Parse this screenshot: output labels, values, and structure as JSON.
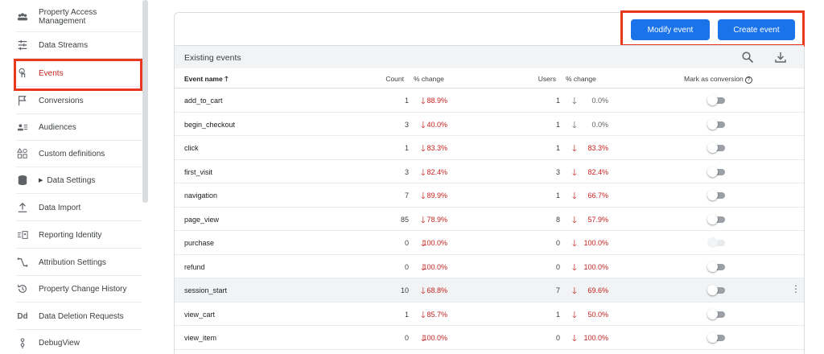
{
  "sidebar": {
    "items": [
      {
        "label": "Property Access Management",
        "icon": "people-icon"
      },
      {
        "label": "Data Streams",
        "icon": "streams-icon"
      },
      {
        "label": "Events",
        "icon": "touch-icon"
      },
      {
        "label": "Conversions",
        "icon": "flag-icon"
      },
      {
        "label": "Audiences",
        "icon": "audience-icon"
      },
      {
        "label": "Custom definitions",
        "icon": "shapes-icon"
      },
      {
        "label": "Data Settings",
        "icon": "database-icon"
      },
      {
        "label": "Data Import",
        "icon": "upload-icon"
      },
      {
        "label": "Reporting Identity",
        "icon": "identity-icon"
      },
      {
        "label": "Attribution Settings",
        "icon": "attribution-icon"
      },
      {
        "label": "Property Change History",
        "icon": "history-icon"
      },
      {
        "label": "Data Deletion Requests",
        "icon": "dd-icon"
      },
      {
        "label": "DebugView",
        "icon": "debug-icon"
      }
    ]
  },
  "actions": {
    "modify": "Modify event",
    "create": "Create event"
  },
  "table": {
    "title": "Existing events",
    "headers": {
      "name": "Event name",
      "count": "Count",
      "count_change": "% change",
      "users": "Users",
      "users_change": "% change",
      "conversion": "Mark as conversion"
    },
    "rows": [
      {
        "name": "add_to_cart",
        "count": "1",
        "count_change": "88.9%",
        "count_dir": "down-red",
        "users": "1",
        "users_change": "0.0%",
        "users_dir": "down-gray",
        "conversion": false,
        "enabled": true
      },
      {
        "name": "begin_checkout",
        "count": "3",
        "count_change": "40.0%",
        "count_dir": "down-red",
        "users": "1",
        "users_change": "0.0%",
        "users_dir": "down-gray",
        "conversion": false,
        "enabled": true
      },
      {
        "name": "click",
        "count": "1",
        "count_change": "83.3%",
        "count_dir": "down-red",
        "users": "1",
        "users_change": "83.3%",
        "users_dir": "down-red",
        "conversion": false,
        "enabled": true
      },
      {
        "name": "first_visit",
        "count": "3",
        "count_change": "82.4%",
        "count_dir": "down-red",
        "users": "3",
        "users_change": "82.4%",
        "users_dir": "down-red",
        "conversion": false,
        "enabled": true
      },
      {
        "name": "navigation",
        "count": "7",
        "count_change": "89.9%",
        "count_dir": "down-red",
        "users": "1",
        "users_change": "66.7%",
        "users_dir": "down-red",
        "conversion": false,
        "enabled": true
      },
      {
        "name": "page_view",
        "count": "85",
        "count_change": "78.9%",
        "count_dir": "down-red",
        "users": "8",
        "users_change": "57.9%",
        "users_dir": "down-red",
        "conversion": false,
        "enabled": true
      },
      {
        "name": "purchase",
        "count": "0",
        "count_change": "100.0%",
        "count_dir": "down-red",
        "users": "0",
        "users_change": "100.0%",
        "users_dir": "down-red",
        "conversion": true,
        "enabled": false
      },
      {
        "name": "refund",
        "count": "0",
        "count_change": "100.0%",
        "count_dir": "down-red",
        "users": "0",
        "users_change": "100.0%",
        "users_dir": "down-red",
        "conversion": false,
        "enabled": true
      },
      {
        "name": "session_start",
        "count": "10",
        "count_change": "68.8%",
        "count_dir": "down-red",
        "users": "7",
        "users_change": "69.6%",
        "users_dir": "down-red",
        "conversion": false,
        "enabled": true
      },
      {
        "name": "view_cart",
        "count": "1",
        "count_change": "85.7%",
        "count_dir": "down-red",
        "users": "1",
        "users_change": "50.0%",
        "users_dir": "down-red",
        "conversion": false,
        "enabled": true
      },
      {
        "name": "view_item",
        "count": "0",
        "count_change": "100.0%",
        "count_dir": "down-red",
        "users": "0",
        "users_change": "100.0%",
        "users_dir": "down-red",
        "conversion": false,
        "enabled": true
      }
    ]
  }
}
